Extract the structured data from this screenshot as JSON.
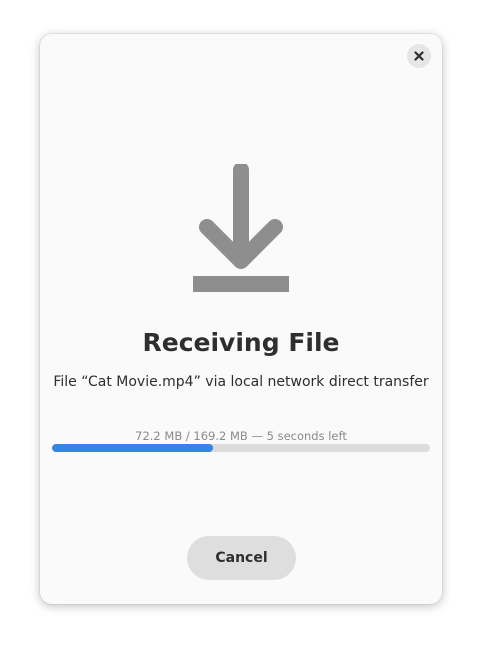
{
  "dialog": {
    "title": "Receiving File",
    "subtitle": "File “Cat Movie.mp4” via local network direct transfer",
    "progress_text": "72.2 MB / 169.2 MB — 5 seconds left",
    "progress_fraction": 0.427,
    "cancel_label": "Cancel",
    "icon": "download-icon",
    "close_icon": "close-icon"
  },
  "colors": {
    "accent": "#3584e4",
    "icon": "#8e8e8e"
  }
}
